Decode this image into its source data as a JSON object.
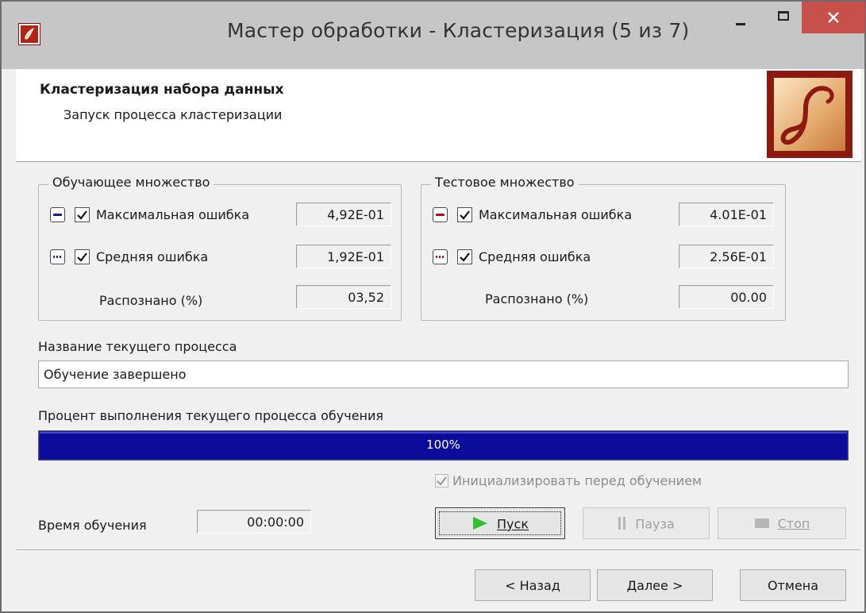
{
  "window": {
    "title": "Мастер обработки - Кластеризация (5 из 7)"
  },
  "header": {
    "title": "Кластеризация набора данных",
    "subtitle": "Запуск процесса кластеризации"
  },
  "train_set": {
    "title": "Обучающее множество",
    "max_error": {
      "label": "Максимальная ошибка",
      "value": "4,92E-01",
      "checked": true,
      "legend_color": "#1a1a8c"
    },
    "avg_error": {
      "label": "Средняя ошибка",
      "value": "1,92E-01",
      "checked": true,
      "legend_color": "#1a1a8c"
    },
    "recognized": {
      "label": "Распознано (%)",
      "value": "03,52"
    }
  },
  "test_set": {
    "title": "Тестовое множество",
    "max_error": {
      "label": "Максимальная ошибка",
      "value": "4.01E-01",
      "checked": true,
      "legend_color": "#b01010"
    },
    "avg_error": {
      "label": "Средняя ошибка",
      "value": "2.56E-01",
      "checked": true,
      "legend_color": "#b01010"
    },
    "recognized": {
      "label": "Распознано (%)",
      "value": "00.00"
    }
  },
  "process": {
    "name_label": "Название текущего процесса",
    "name_value": "Обучение завершено"
  },
  "progress": {
    "label": "Процент выполнения текущего процесса обучения",
    "text": "100%",
    "value": 1.0
  },
  "init_checkbox": {
    "label": "Инициализировать перед обучением",
    "checked": true,
    "enabled": false
  },
  "training_time": {
    "label": "Время обучения",
    "value": "00:00:00"
  },
  "controls": {
    "start": "Пуск",
    "pause": "Пауза",
    "stop": "Стоп"
  },
  "footer": {
    "back": "< Назад",
    "next": "Далее >",
    "cancel": "Отмена"
  }
}
